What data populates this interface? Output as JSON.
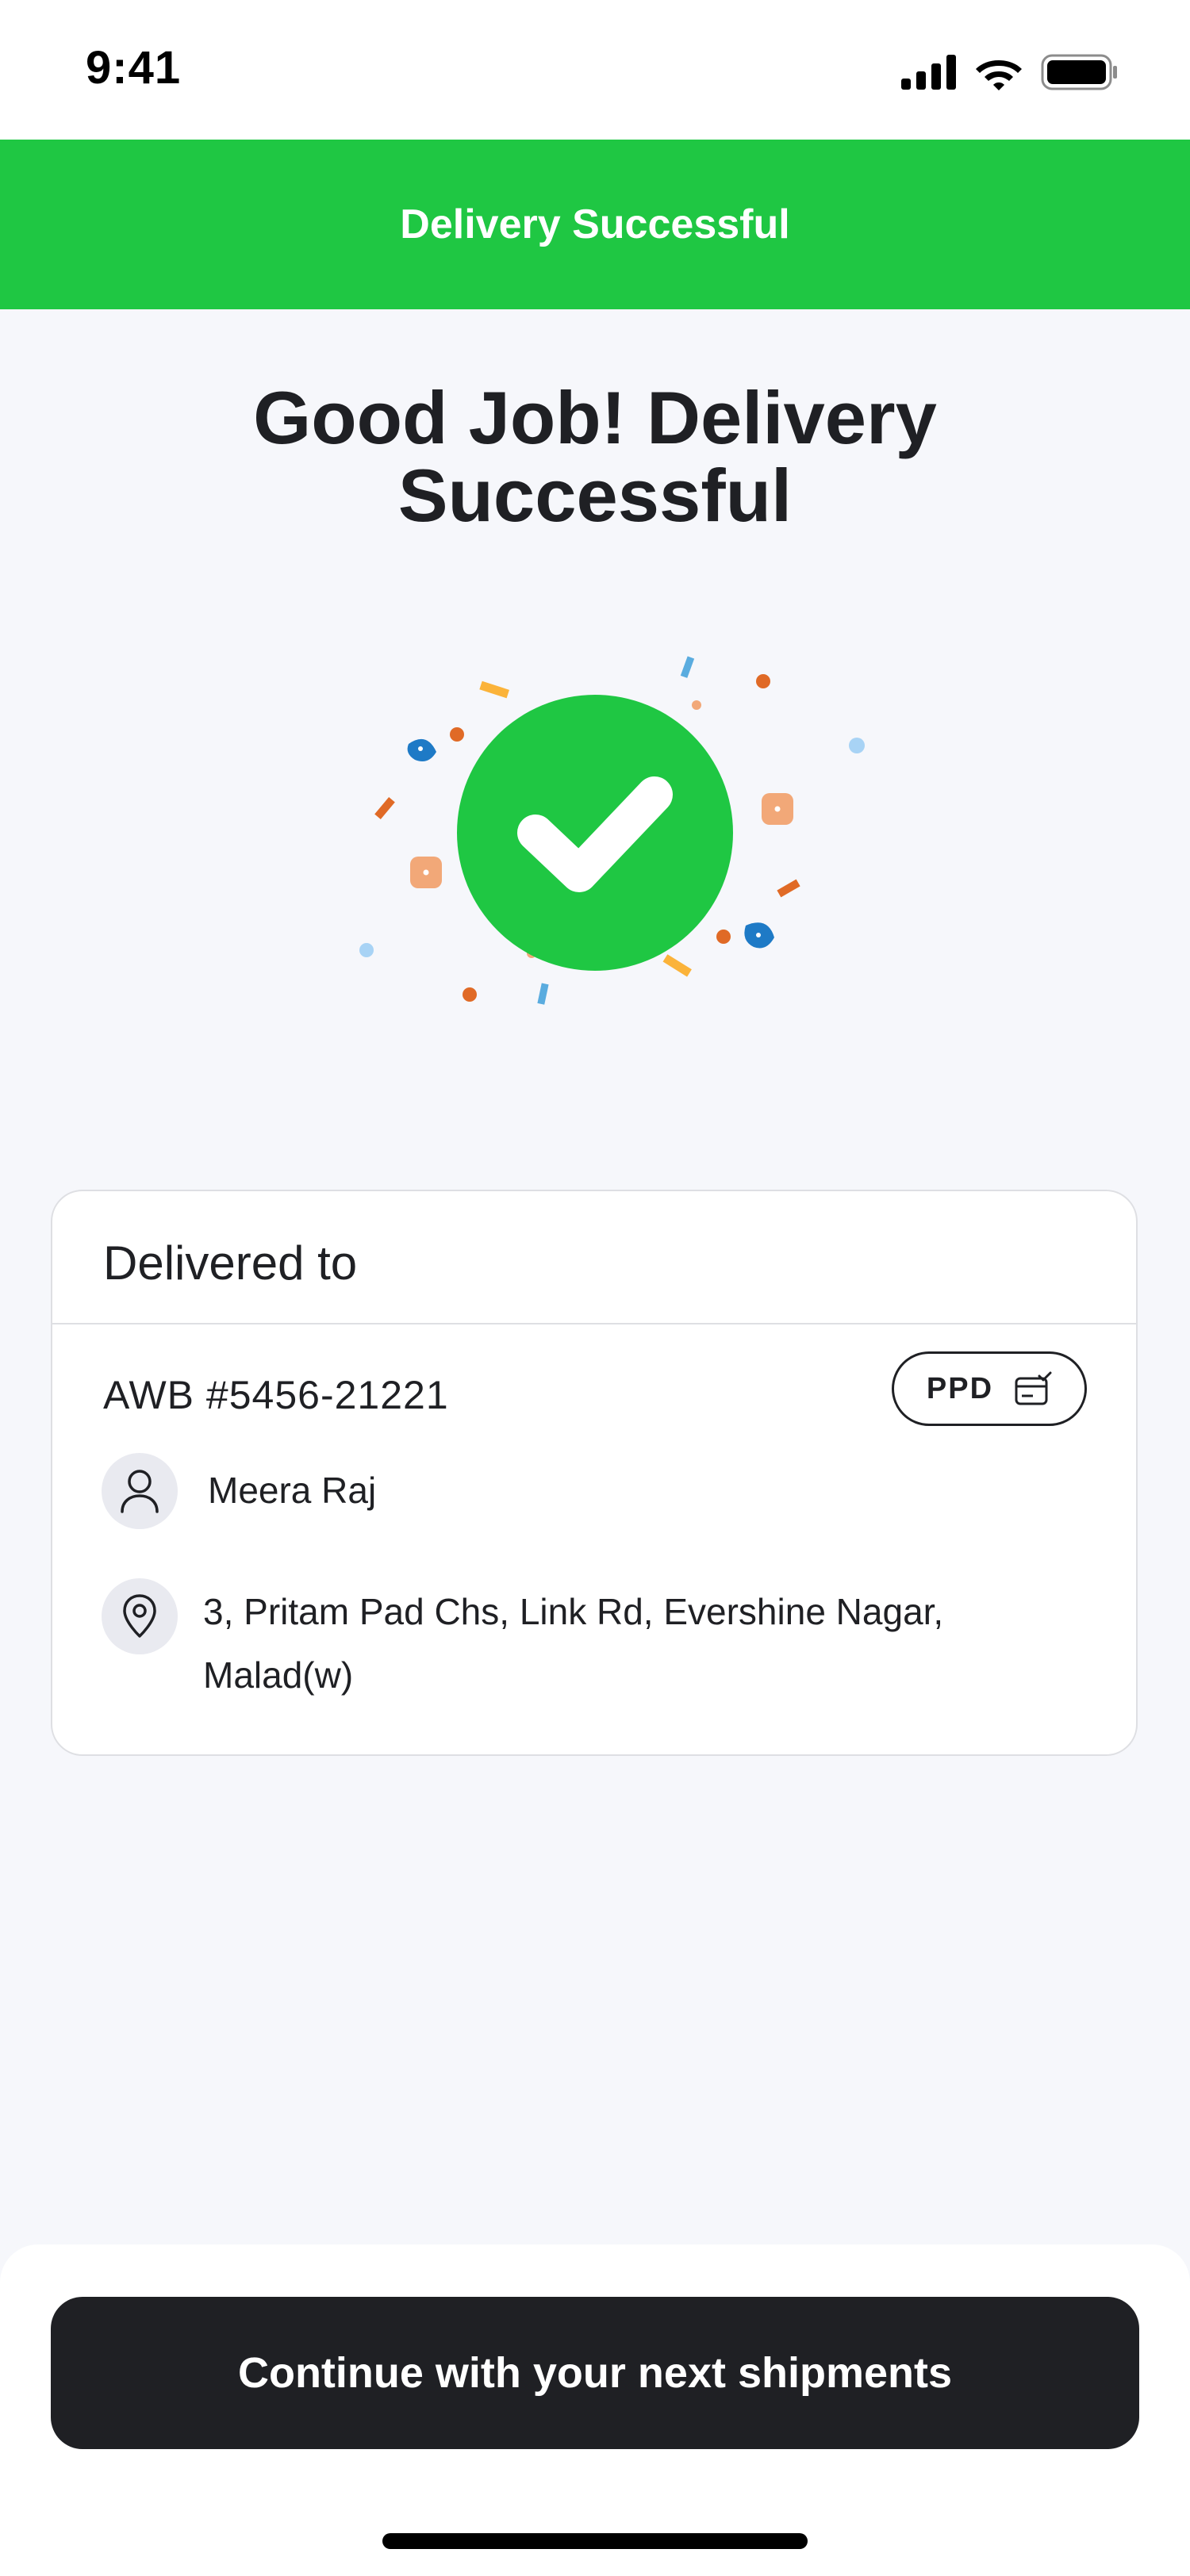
{
  "status_bar": {
    "time": "9:41"
  },
  "header": {
    "title": "Delivery Successful"
  },
  "headline": {
    "line1": "Good Job! Delivery",
    "line2": "Successful"
  },
  "colors": {
    "success_green": "#1fc743",
    "dark": "#1f2024",
    "background": "#f6f7fb"
  },
  "icons": {
    "success": "check-circle-icon",
    "person": "person-icon",
    "location": "location-pin-icon",
    "payment": "wallet-icon"
  },
  "delivery_card": {
    "title": "Delivered to",
    "awb": "AWB #5456-21221",
    "payment_badge": "PPD",
    "recipient_name": "Meera Raj",
    "address": "3, Pritam Pad Chs, Link Rd, Evershine Nagar, Malad(w)"
  },
  "cta": {
    "label": "Continue with your next shipments"
  }
}
